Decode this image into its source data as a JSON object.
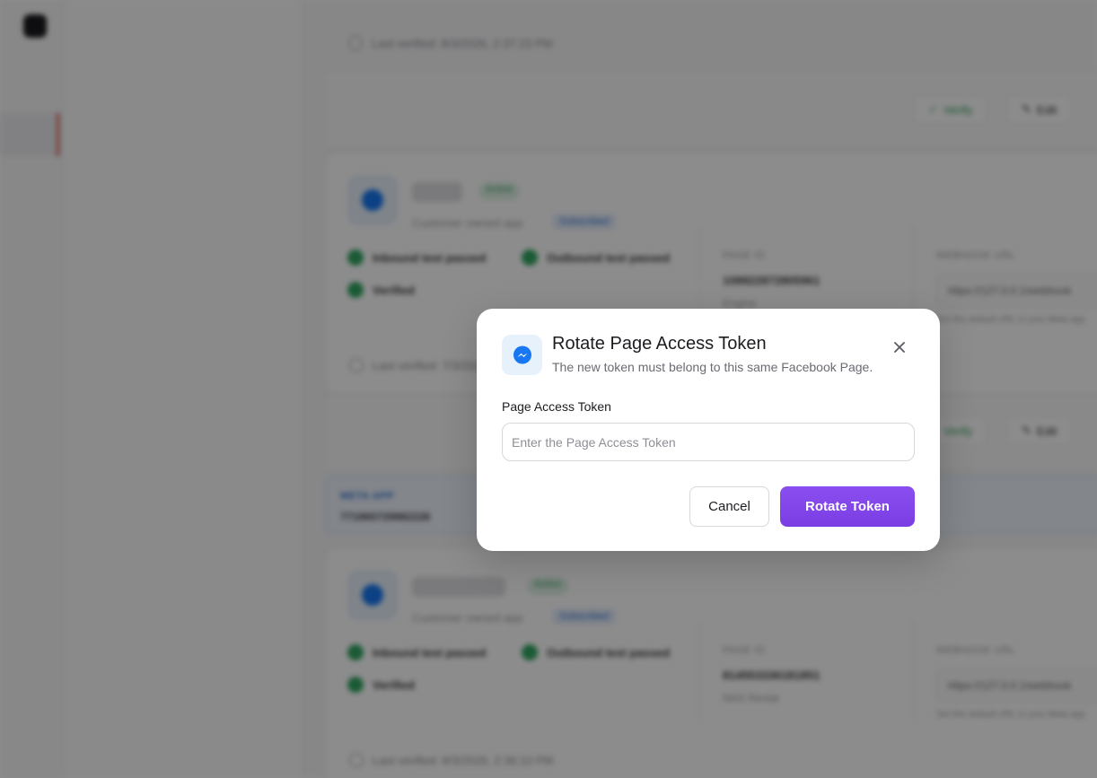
{
  "background": {
    "cards": [
      {
        "last_verified": "Last verified: 8/3/2026, 2:37:23 PM"
      },
      {
        "name": "Page",
        "status": "Active",
        "owner_text": "Customer owned app",
        "owner_tag": "Subscribed",
        "checks": [
          "Inbound test passed",
          "Outbound test passed",
          "Verified"
        ],
        "page_id_label": "PAGE ID",
        "page_id": "108822872805961",
        "page_sub": "Engine",
        "webhook_label": "WEBHOOK URL",
        "webhook_url": "https://127.0.0.1/webhook",
        "webhook_hint": "Set this default URL in your Meta app",
        "last_verified": "Last verified: 7/3/2026"
      },
      {
        "name": "Messenger",
        "status": "Active",
        "owner_text": "Customer owned app",
        "owner_tag": "Subscribed",
        "checks": [
          "Inbound test passed",
          "Outbound test passed",
          "Verified"
        ],
        "page_id_label": "PAGE ID",
        "page_id": "814553336181851",
        "page_sub": "NAS Rental",
        "webhook_label": "WEBHOOK URL",
        "webhook_url": "https://127.0.0.1/webhook",
        "webhook_hint": "Set this default URL in your Meta app",
        "last_verified": "Last verified: 8/3/2026, 2:36:10 PM"
      }
    ],
    "meta_app": {
      "label": "META APP",
      "value": "771965729982228"
    },
    "buttons": {
      "verify": "Verify",
      "edit": "Edit"
    }
  },
  "dialog": {
    "icon": "messenger-icon",
    "title": "Rotate Page Access Token",
    "subtitle": "The new token must belong to this same Facebook Page.",
    "close_icon": "close-icon",
    "field_label": "Page Access Token",
    "input": {
      "value": "",
      "placeholder": "Enter the Page Access Token"
    },
    "cancel_label": "Cancel",
    "submit_label": "Rotate Token"
  },
  "colors": {
    "accent": "#7a3de3",
    "messenger": "#1877f2",
    "success": "#30a560",
    "overlay": "rgba(0,0,0,0.45)"
  }
}
